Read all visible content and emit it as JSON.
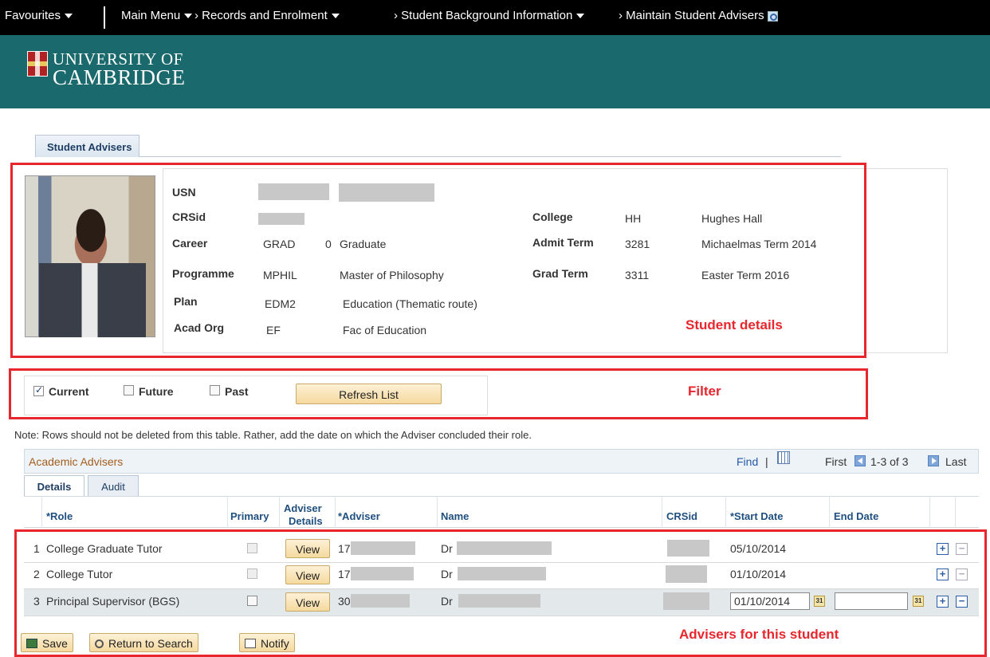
{
  "nav": {
    "favourites": "Favourites",
    "main_menu": "Main Menu",
    "crumb1": "› Records and Enrolment",
    "crumb2": "› Student Background Information",
    "crumb3": "› Maintain Student Advisers",
    "search_icon": "search-page-icon"
  },
  "banner": {
    "line1": "UNIVERSITY OF",
    "line2": "CAMBRIDGE",
    "brand_color": "#1a6a6d"
  },
  "page_tab": "Student Advisers",
  "student": {
    "usn_label": "USN",
    "crsid_label": "CRSid",
    "career_label": "Career",
    "career_code": "GRAD",
    "career_num": "0",
    "career_desc": "Graduate",
    "programme_label": "Programme",
    "programme_code": "MPHIL",
    "programme_desc": "Master of Philosophy",
    "plan_label": "Plan",
    "plan_code": "EDM2",
    "plan_desc": "Education (Thematic route)",
    "acadorg_label": "Acad Org",
    "acadorg_code": "EF",
    "acadorg_desc": "Fac of Education",
    "college_label": "College",
    "college_code": "HH",
    "college_desc": "Hughes Hall",
    "admit_label": "Admit Term",
    "admit_code": "3281",
    "admit_desc": "Michaelmas Term 2014",
    "grad_label": "Grad Term",
    "grad_code": "3311",
    "grad_desc": "Easter Term 2016"
  },
  "annotations": {
    "student_details": "Student details",
    "filter": "Filter",
    "advisers": "Advisers for this student",
    "highlight_color": "#e8262d"
  },
  "filter": {
    "current": "Current",
    "current_checked": true,
    "future": "Future",
    "future_checked": false,
    "past": "Past",
    "past_checked": false,
    "refresh": "Refresh List"
  },
  "note": "Note: Rows should not be deleted from this table. Rather, add the date on which the Adviser concluded their role.",
  "grid": {
    "title": "Academic Advisers",
    "find": "Find",
    "sep": "|",
    "first": "First",
    "range": "1-3 of 3",
    "last": "Last",
    "tabs": [
      "Details",
      "Audit"
    ],
    "columns": {
      "role": "*Role",
      "primary": "Primary",
      "adviser_details_1": "Adviser",
      "adviser_details_2": "Details",
      "adviser": "*Adviser",
      "name": "Name",
      "crsid": "CRSid",
      "start": "*Start Date",
      "end": "End Date"
    },
    "rows": [
      {
        "num": "1",
        "role": "College Graduate Tutor",
        "view": "View",
        "adviser": "17",
        "name": "Dr",
        "start": "05/10/2014",
        "end": ""
      },
      {
        "num": "2",
        "role": "College Tutor",
        "view": "View",
        "adviser": "17",
        "name": "Dr",
        "start": "01/10/2014",
        "end": ""
      },
      {
        "num": "3",
        "role": "Principal Supervisor (BGS)",
        "view": "View",
        "adviser": "30",
        "name": "Dr",
        "start": "01/10/2014",
        "end": ""
      }
    ]
  },
  "footer": {
    "save": "Save",
    "return": "Return to Search",
    "notify": "Notify"
  }
}
